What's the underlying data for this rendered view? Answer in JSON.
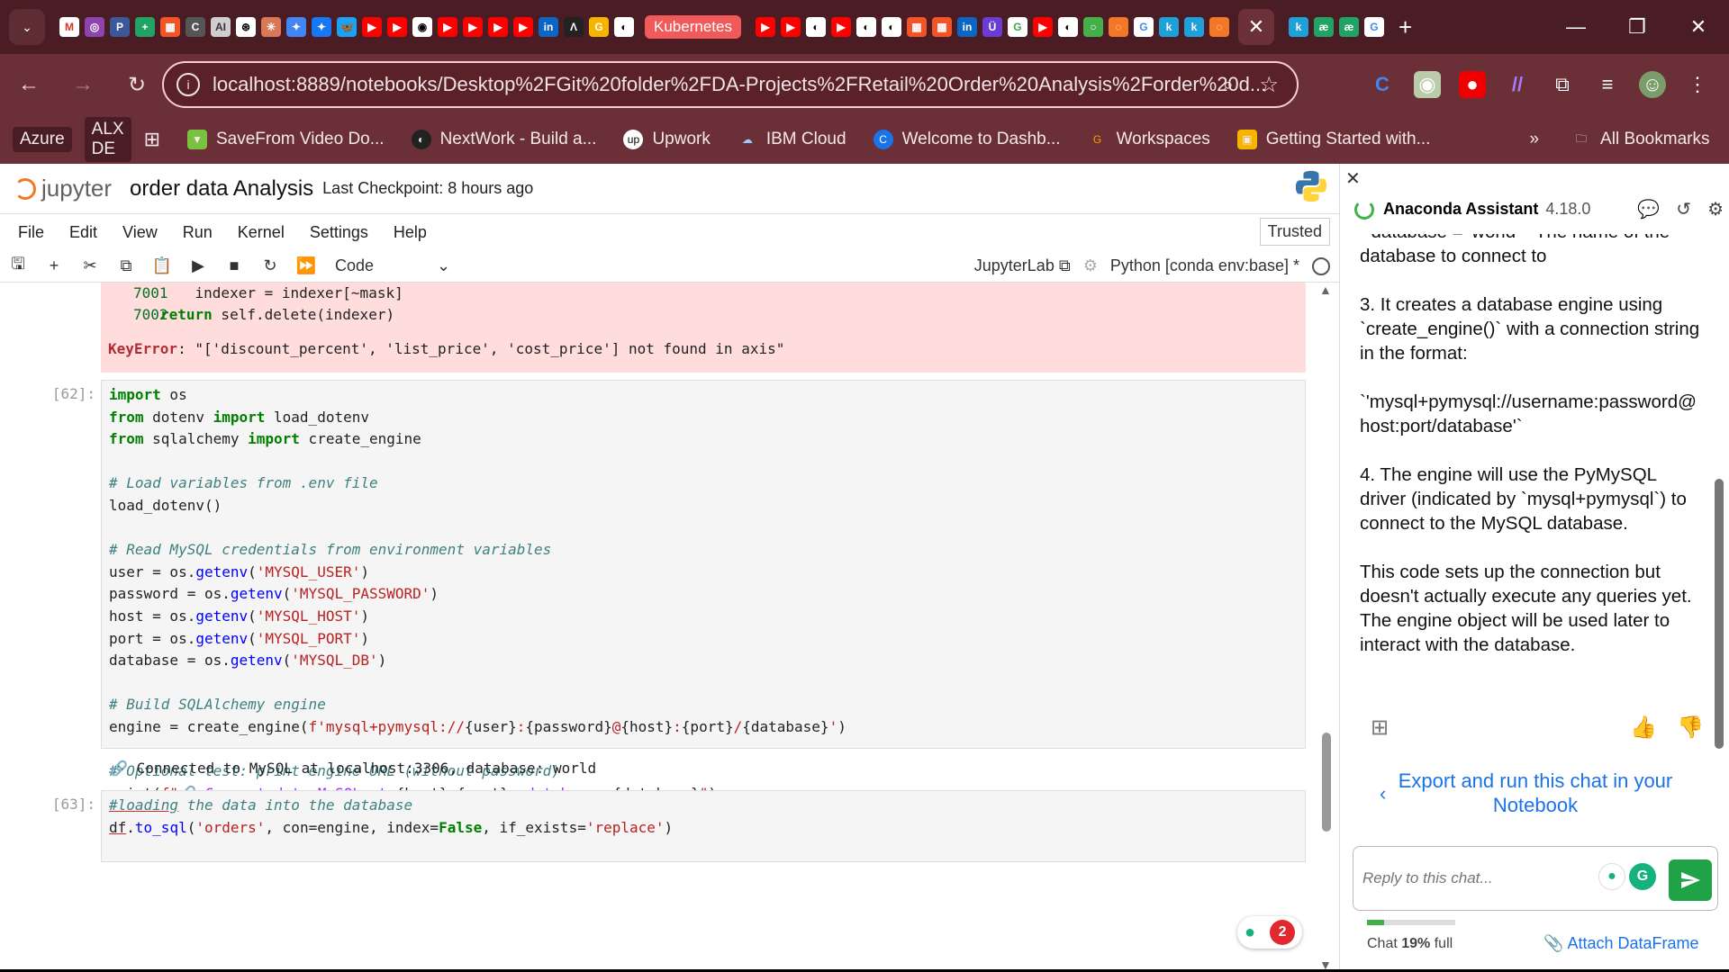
{
  "browser": {
    "tab_pill": "Kubernetes",
    "url": "localhost:8889/notebooks/Desktop%2FGit%20folder%2FDA-Projects%2FRetail%20Order%20Analysis%2Forder%20d...",
    "bookmarks": [
      {
        "label": "Azure",
        "tag": true
      },
      {
        "label": "ALX DE",
        "tag": true
      },
      {
        "label": "SaveFrom Video Do..."
      },
      {
        "label": "NextWork - Build a..."
      },
      {
        "label": "Upwork"
      },
      {
        "label": "IBM Cloud"
      },
      {
        "label": "Welcome to Dashb..."
      },
      {
        "label": "Workspaces"
      },
      {
        "label": "Getting Started with..."
      }
    ],
    "all_bookmarks": "All Bookmarks"
  },
  "jupyter": {
    "logo": "jupyter",
    "title": "order data Analysis",
    "checkpoint": "Last Checkpoint: 8 hours ago",
    "menu": [
      "File",
      "Edit",
      "View",
      "Run",
      "Kernel",
      "Settings",
      "Help"
    ],
    "trusted": "Trusted",
    "cell_type": "Code",
    "jupyterlab": "JupyterLab",
    "kernel": "Python [conda env:base] *",
    "error_lines": [
      {
        "num": "7001",
        "code": "    indexer = indexer[~mask]"
      },
      {
        "num": "7002",
        "code": "return self.delete(indexer)"
      }
    ],
    "error_name": "KeyError",
    "error_msg": ": \"['discount_percent', 'list_price', 'cost_price'] not found in axis\"",
    "cell62_prompt": "[62]:",
    "cell62_output": "Connected to MySQL at localhost:3306, database: world",
    "cell63_prompt": "[63]:",
    "fab_count": "2"
  },
  "assistant": {
    "title": "Anaconda Assistant",
    "version": "4.18.0",
    "clipped": "- database = 'world' - The name of the database to connect to",
    "p3": "3. It creates a database engine using `create_engine()` with a connection string in the format:",
    "p3b": "`'mysql+pymysql://username:password@host:port/database'`",
    "p4": "4. The engine will use the PyMySQL driver (indicated by `mysql+pymysql`) to connect to the MySQL database.",
    "p5": "This code sets up the connection but doesn't actually execute any queries yet. The engine object will be used later to interact with the database.",
    "export": "Export and run this chat in your Notebook",
    "reply_placeholder": "Reply to this chat...",
    "chat_label": "Chat",
    "chat_pct": "19%",
    "chat_full": "full",
    "chat_usage": 0.19,
    "attach": "Attach DataFrame"
  }
}
